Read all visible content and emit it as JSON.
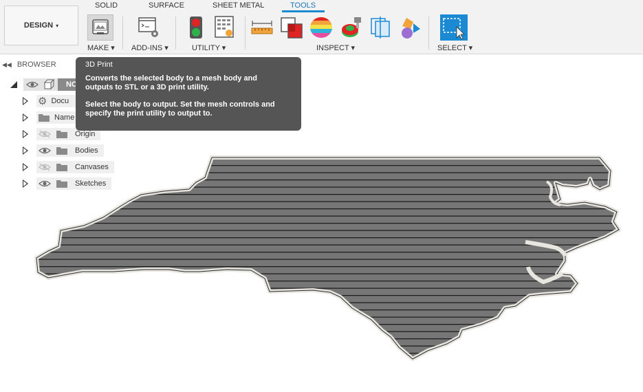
{
  "workspace": {
    "label": "DESIGN",
    "caret": "▾"
  },
  "tabs": [
    {
      "label": "SOLID",
      "active": false
    },
    {
      "label": "SURFACE",
      "active": false
    },
    {
      "label": "SHEET METAL",
      "active": false
    },
    {
      "label": "TOOLS",
      "active": true
    }
  ],
  "groups": {
    "make": "MAKE ▾",
    "addins": "ADD-INS ▾",
    "utility": "UTILITY ▾",
    "inspect": "INSPECT ▾",
    "select": "SELECT ▾"
  },
  "icons": {
    "make": "3d-print-icon",
    "addins": "scripts-addins-icon",
    "utility_1": "traffic-light-icon",
    "utility_2": "task-manager-icon",
    "inspect_1": "measure-icon",
    "inspect_2": "interference-icon",
    "inspect_3": "zebra-analysis-icon",
    "inspect_4": "draft-analysis-icon",
    "inspect_5": "section-analysis-icon",
    "inspect_6": "center-of-mass-icon",
    "select": "select-window-icon"
  },
  "browser": {
    "label": "BROWSER",
    "root": "NC",
    "items": [
      {
        "label": "Docu",
        "icon": "gear-icon",
        "eye": false
      },
      {
        "label": "Name",
        "icon": "folder-icon",
        "eye": false
      },
      {
        "label": "Origin",
        "icon": "folder-icon",
        "eye": "hidden"
      },
      {
        "label": "Bodies",
        "icon": "folder-icon",
        "eye": "visible"
      },
      {
        "label": "Canvases",
        "icon": "folder-icon",
        "eye": "hidden"
      },
      {
        "label": "Sketches",
        "icon": "folder-icon",
        "eye": "visible"
      }
    ]
  },
  "tooltip": {
    "title": "3D Print",
    "line1": "Converts the selected body to a mesh body and",
    "line2": "outputs to STL or a 3D print utility.",
    "line3": "Select the body to output. Set the mesh controls and",
    "line4": "specify the print utility to output to."
  },
  "colors": {
    "accent": "#1b8ad3",
    "model_fill": "#757575",
    "model_outline": "#e8e6e0",
    "tooltip_bg": "#555555"
  }
}
